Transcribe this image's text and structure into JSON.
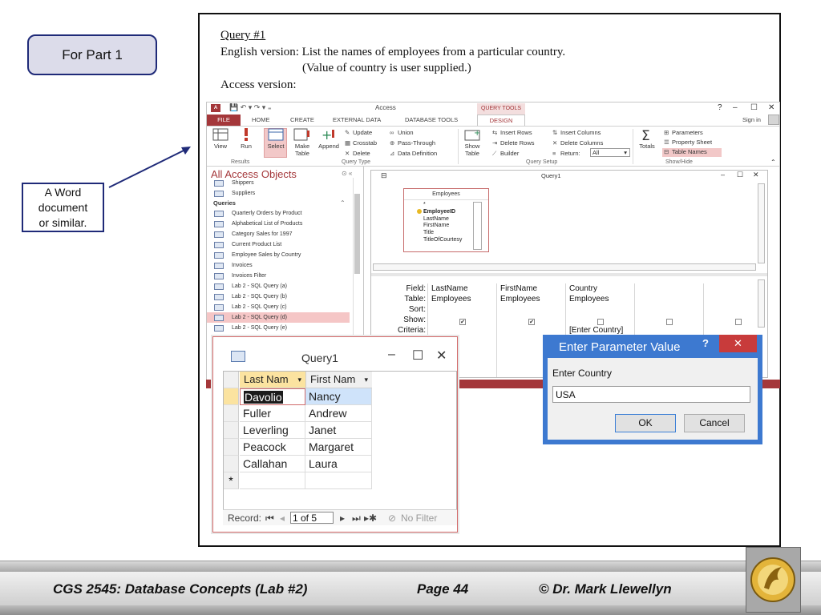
{
  "slide": {
    "part_label": "For Part 1",
    "word_note": "A Word\ndocument\nor similar.",
    "query_title": "Query #1",
    "english_line": "English version:  List the names of employees from a particular country.",
    "value_note": "(Value of country is user supplied.)",
    "access_line": "Access version:"
  },
  "access": {
    "app_title": "Access",
    "context_tools": "QUERY TOOLS",
    "tabs": [
      "FILE",
      "HOME",
      "CREATE",
      "EXTERNAL DATA",
      "DATABASE TOOLS",
      "DESIGN"
    ],
    "sign_in": "Sign in",
    "help": "?",
    "ribbon": {
      "view": "View",
      "run": "Run",
      "select": "Select",
      "make_table": "Make Table",
      "append": "Append",
      "update": "Update",
      "crosstab": "Crosstab",
      "delete": "Delete",
      "union": "Union",
      "pass_through": "Pass-Through",
      "data_definition": "Data Definition",
      "show_table": "Show Table",
      "insert_rows": "Insert Rows",
      "delete_rows": "Delete Rows",
      "builder": "Builder",
      "insert_columns": "Insert Columns",
      "delete_columns": "Delete Columns",
      "return_label": "Return:",
      "return_value": "All",
      "totals": "Totals",
      "parameters": "Parameters",
      "property_sheet": "Property Sheet",
      "table_names": "Table Names",
      "groups": [
        "Results",
        "Query Type",
        "Query Setup",
        "Show/Hide"
      ]
    },
    "nav": {
      "title": "All Access Objects",
      "tables": [
        "Shippers",
        "Suppliers"
      ],
      "category": "Queries",
      "queries": [
        "Quarterly Orders by Product",
        "Alphabetical List of Products",
        "Category Sales for 1997",
        "Current Product List",
        "Employee Sales by Country",
        "Invoices",
        "Invoices Filter",
        "Lab 2 - SQL Query (a)",
        "Lab 2 - SQL Query (b)",
        "Lab 2 - SQL Query (c)",
        "Lab 2 - SQL Query (d)",
        "Lab 2 - SQL Query (e)"
      ]
    },
    "query_window": {
      "title": "Query1",
      "table_name": "Employees",
      "fields": [
        "*",
        "EmployeeID",
        "LastName",
        "FirstName",
        "Title",
        "TitleOfCourtesy"
      ],
      "row_labels": [
        "Field:",
        "Table:",
        "Sort:",
        "Show:",
        "Criteria:"
      ],
      "columns": [
        {
          "field": "LastName",
          "table": "Employees",
          "show": true,
          "criteria": ""
        },
        {
          "field": "FirstName",
          "table": "Employees",
          "show": true,
          "criteria": ""
        },
        {
          "field": "Country",
          "table": "Employees",
          "show": false,
          "criteria": "[Enter Country]"
        },
        {
          "field": "",
          "table": "",
          "show": false,
          "criteria": ""
        },
        {
          "field": "",
          "table": "",
          "show": false,
          "criteria": ""
        }
      ]
    }
  },
  "datasheet": {
    "title": "Query1",
    "headers": [
      "Last Nam",
      "First Nam"
    ],
    "rows": [
      [
        "Davolio",
        "Nancy"
      ],
      [
        "Fuller",
        "Andrew"
      ],
      [
        "Leverling",
        "Janet"
      ],
      [
        "Peacock",
        "Margaret"
      ],
      [
        "Callahan",
        "Laura"
      ]
    ],
    "new_row_marker": "*",
    "record_label": "Record:",
    "record_value": "1 of 5",
    "no_filter": "No Filter"
  },
  "dialog": {
    "title": "Enter Parameter Value",
    "help": "?",
    "close": "✕",
    "prompt": "Enter Country",
    "value": "USA",
    "ok": "OK",
    "cancel": "Cancel"
  },
  "footer": {
    "course": "CGS 2545: Database Concepts  (Lab #2)",
    "page": "Page 44",
    "author": "© Dr. Mark Llewellyn"
  },
  "colors": {
    "access_accent": "#a4373a",
    "dialog_blue": "#3d79d0",
    "callout_border": "#1f2a78"
  }
}
